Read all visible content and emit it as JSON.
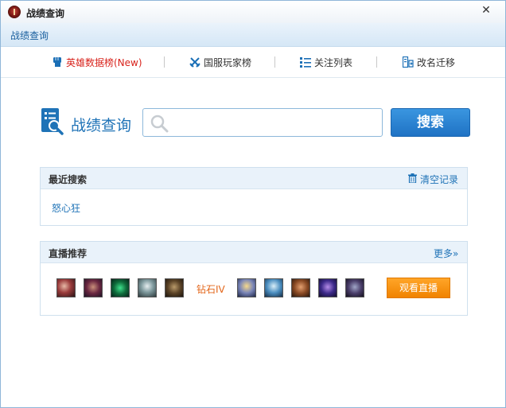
{
  "window": {
    "title": "战绩查询",
    "close_icon": "close-icon"
  },
  "subbar": {
    "title": "战绩查询"
  },
  "nav": {
    "items": [
      {
        "label": "英雄数据榜(New)",
        "icon": "fist-icon",
        "active": true
      },
      {
        "label": "国服玩家榜",
        "icon": "crossed-swords-icon",
        "active": false
      },
      {
        "label": "关注列表",
        "icon": "list-icon",
        "active": false
      },
      {
        "label": "改名迁移",
        "icon": "rename-icon",
        "active": false
      }
    ]
  },
  "search": {
    "heading": "战绩查询",
    "placeholder": "",
    "value": "",
    "button_label": "搜索"
  },
  "recent": {
    "title": "最近搜索",
    "clear_label": "清空记录",
    "items": [
      "怒心狂"
    ]
  },
  "live": {
    "title": "直播推荐",
    "more_label": "更多»",
    "rank_label": "钻石IV",
    "watch_label": "观看直播",
    "avatars": [
      "champion-avatar-1",
      "champion-avatar-2",
      "champion-avatar-3",
      "champion-avatar-4",
      "champion-avatar-5",
      "champion-avatar-6",
      "champion-avatar-7",
      "champion-avatar-8",
      "champion-avatar-9",
      "champion-avatar-10"
    ]
  },
  "colors": {
    "accent": "#1f73b7",
    "active_nav": "#d8231c",
    "watch_button": "#f08300",
    "rank": "#e3661a"
  }
}
